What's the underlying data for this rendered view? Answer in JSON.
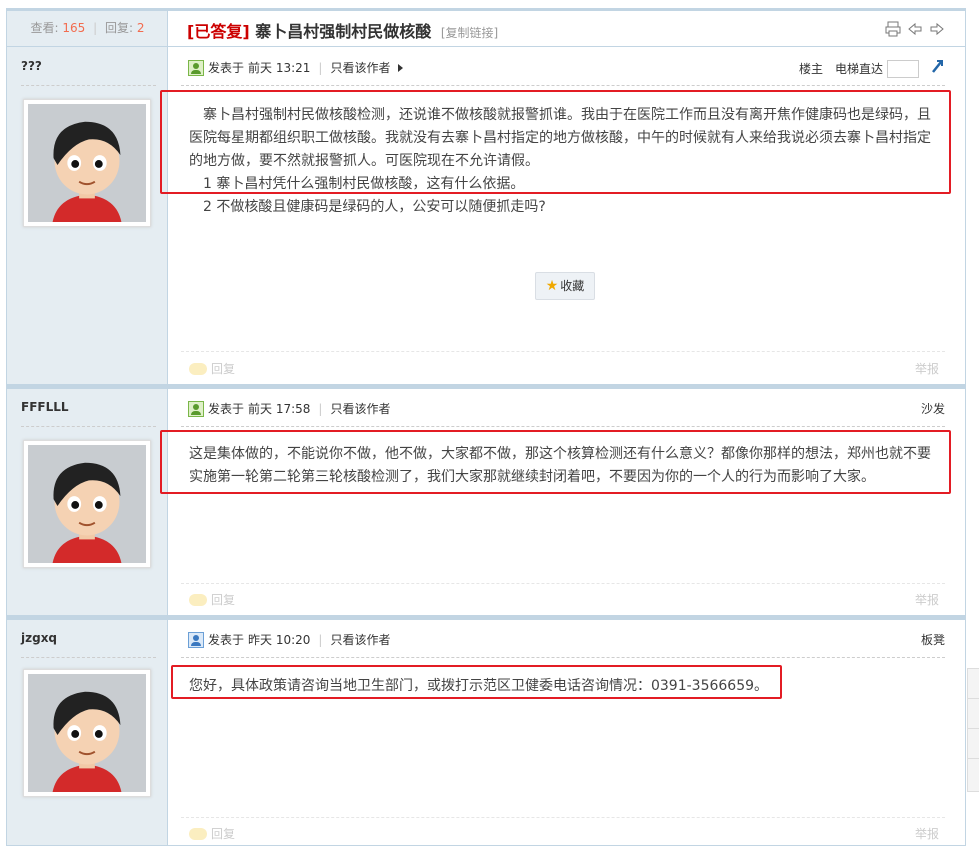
{
  "header": {
    "views_label": "查看:",
    "views": "165",
    "replies_label": "回复:",
    "replies": "2",
    "tag": "[已答复]",
    "title": "寨卜昌村强制村民做核酸",
    "copy_link": "[复制链接]",
    "icons": [
      "print-icon",
      "prev-thread-icon",
      "next-thread-icon"
    ]
  },
  "posts": [
    {
      "author": "???",
      "posted_label": "发表于",
      "time": "前天 13:21",
      "author_only": "只看该作者",
      "floor": "楼主",
      "elevator_label": "电梯直达",
      "paragraphs": [
        "寨卜昌村强制村民做核酸检测，还说谁不做核酸就报警抓谁。我由于在医院工作而且没有离开焦作健康码也是绿码，且医院每星期都组织职工做核酸。我就没有去寨卜昌村指定的地方做核酸，中午的时候就有人来给我说必须去寨卜昌村指定的地方做，要不然就报警抓人。可医院现在不允许请假。",
        "1 寨卜昌村凭什么强制村民做核酸，这有什么依据。",
        "2 不做核酸且健康码是绿码的人，公安可以随便抓走吗?"
      ],
      "favorite": "收藏",
      "reply": "回复",
      "report": "举报"
    },
    {
      "author": "FFFLLL",
      "posted_label": "发表于",
      "time": "前天 17:58",
      "author_only": "只看该作者",
      "floor": "沙发",
      "paragraphs": [
        "这是集体做的，不能说你不做，他不做，大家都不做，那这个核算检测还有什么意义？都像你那样的想法，郑州也就不要实施第一轮第二轮第三轮核酸检测了，我们大家那就继续封闭着吧，不要因为你的一个人的行为而影响了大家。"
      ],
      "reply": "回复",
      "report": "举报"
    },
    {
      "author": "jzgxq",
      "posted_label": "发表于",
      "time": "昨天 10:20",
      "author_only": "只看该作者",
      "floor": "板凳",
      "paragraphs": [
        "您好，具体政策请咨询当地卫生部门，或拨打示范区卫健委电话咨询情况：0391-3566659。"
      ],
      "reply": "回复",
      "report": "举报"
    }
  ],
  "colors": {
    "sidebar": "#e5edf2",
    "border": "#c2d5e3",
    "tag_red": "#cc0000",
    "count_orange": "#f26c4f",
    "highlight_box": "#e31c24"
  }
}
